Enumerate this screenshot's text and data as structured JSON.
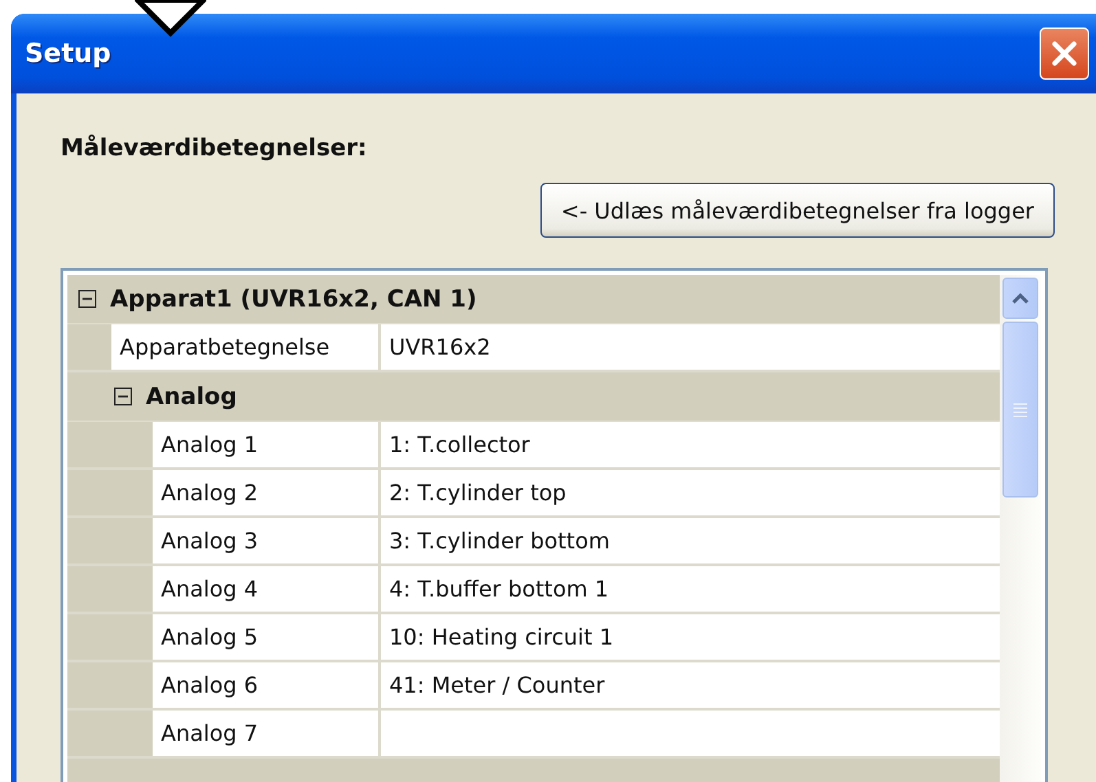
{
  "window": {
    "title": "Setup"
  },
  "heading": "Måleværdibetegnelser:",
  "read_button": "<- Udlæs måleværdibetegnelser fra logger",
  "tree": [
    {
      "label": "Apparat1 (UVR16x2, CAN 1)",
      "expanded": true,
      "children": [
        {
          "kind": "property",
          "name": "Apparatbetegnelse",
          "value": "UVR16x2"
        },
        {
          "kind": "group",
          "label": "Analog",
          "expanded": true,
          "children": [
            {
              "kind": "property",
              "name": "Analog 1",
              "value": "1: T.collector"
            },
            {
              "kind": "property",
              "name": "Analog 2",
              "value": "2: T.cylinder top"
            },
            {
              "kind": "property",
              "name": "Analog 3",
              "value": "3: T.cylinder bottom"
            },
            {
              "kind": "property",
              "name": "Analog 4",
              "value": "4: T.buffer bottom 1"
            },
            {
              "kind": "property",
              "name": "Analog 5",
              "value": "10: Heating circuit 1"
            },
            {
              "kind": "property",
              "name": "Analog 6",
              "value": "41: Meter / Counter"
            },
            {
              "kind": "property",
              "name": "Analog 7"
            }
          ]
        }
      ]
    }
  ]
}
